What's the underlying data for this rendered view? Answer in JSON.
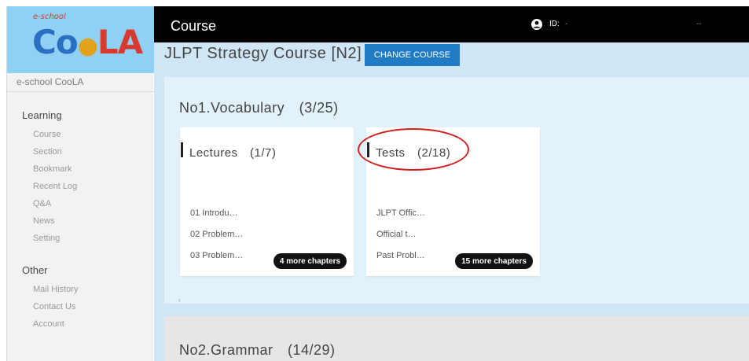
{
  "brand": {
    "logo_small": "e-school",
    "logo_co": "Co",
    "logo_dot": "●",
    "logo_la": "LA",
    "site_name": "e-school CooLA"
  },
  "sidebar": {
    "learning_heading": "Learning",
    "learning_items": [
      "Course",
      "Section",
      "Bookmark",
      "Recent Log",
      "Q&A",
      "News",
      "Setting"
    ],
    "other_heading": "Other",
    "other_items": [
      "Mail History",
      "Contact Us",
      "Account"
    ]
  },
  "topbar": {
    "title": "Course",
    "user_icon": "user-circle-icon",
    "id_label": "ID:",
    "id_value": "-",
    "extra": "--"
  },
  "course": {
    "title": "JLPT Strategy Course [N2]",
    "change_button": "CHANGE COURSE"
  },
  "sections": [
    {
      "title": "No1.Vocabulary　(3/25)",
      "cards": [
        {
          "title": "Lectures　(1/7)",
          "items": [
            "01 Introdu…",
            "02 Problem…",
            "03 Problem…"
          ],
          "more": "4 more chapters"
        },
        {
          "title": "Tests　(2/18)",
          "items": [
            "JLPT Offic…",
            "Official t…",
            "Past Probl…"
          ],
          "more": "15 more chapters"
        }
      ],
      "scroll_hint": "‹"
    },
    {
      "title": "No2.Grammar　(14/29)"
    }
  ],
  "colors": {
    "sidebar_bg": "#f2f2f2",
    "logo_bg": "#8fd0f4",
    "topbar_bg": "#000000",
    "main_bg": "#cfe6f7",
    "section_bg": "#e3f1fa",
    "accent_button": "#1f7bc4",
    "annotation": "#d12020"
  }
}
